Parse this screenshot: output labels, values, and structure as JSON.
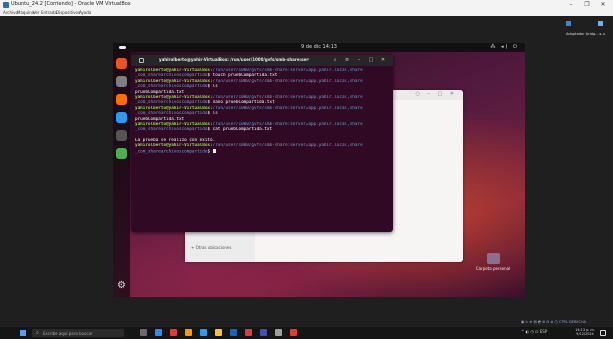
{
  "host_window": {
    "title": "Ubuntu_24.2 [Corriendo] - Oracle VM VirtualBox",
    "menu": [
      "Archivo",
      "Máquina",
      "Ver",
      "Entrada",
      "Dispositivos",
      "Ayuda"
    ],
    "controls": [
      "–",
      "❐",
      "✕"
    ]
  },
  "guest": {
    "clock": "9 de dic 14:13",
    "system_icons": "⁂ ◂) ⏻",
    "terminal": {
      "title": "yahirolberto@yahir-VirtualBox: /run/user/1000/gvfs/smb-share:server=appp...",
      "buttons": [
        "⌕",
        "≡",
        "–",
        "□",
        "✕"
      ],
      "lines": [
        {
          "user": "yahirolberto@yahir-VirtualBox:",
          "path": "/run/user/1000/gvfs/smb-share:server=app.yahir.local,share",
          "cmd": ""
        },
        {
          "user": "",
          "path": "_com_sharearchivoscompartido",
          "cmd": "$ touch pruebCompartida.txt"
        },
        {
          "user": "yahirolberto@yahir-VirtualBox:",
          "path": "/run/user/1000/gvfs/smb-share:server=app.yahir.local,share",
          "cmd": ""
        },
        {
          "user": "",
          "path": "_com_sharearchivoscompartido",
          "cmd": "$ ls"
        },
        {
          "user": "",
          "path": "",
          "cmd": "pruebCompartida.txt"
        },
        {
          "user": "yahirolberto@yahir-VirtualBox:",
          "path": "/run/user/1000/gvfs/smb-share:server=app.yahir.local,share",
          "cmd": ""
        },
        {
          "user": "",
          "path": "_com_sharearchivoscompartido",
          "cmd": "$ nano pruebCompartida.txt"
        },
        {
          "user": "yahirolberto@yahir-VirtualBox:",
          "path": "/run/user/1000/gvfs/smb-share:server=app.yahir.local,share",
          "cmd": ""
        },
        {
          "user": "",
          "path": "_com_sharearchivoscompartido",
          "cmd": "$ ls"
        },
        {
          "user": "",
          "path": "",
          "cmd": "pruebCompartida.txt"
        },
        {
          "user": "yahirolberto@yahir-VirtualBox:",
          "path": "/run/user/1000/gvfs/smb-share:server=app.yahir.local,share",
          "cmd": ""
        },
        {
          "user": "",
          "path": "_com_sharearchivoscompartido",
          "cmd": "$ cat pruebCompartida.txt"
        },
        {
          "user": "",
          "path": "",
          "cmd": ""
        },
        {
          "user": "",
          "path": "",
          "cmd": "La prueba se realizo con exito."
        },
        {
          "user": "yahirolberto@yahir-VirtualBox:",
          "path": "/run/user/1000/gvfs/smb-share:server=app.yahir.local,share",
          "cmd": ""
        },
        {
          "user": "",
          "path": "_com_sharearchivoscompartido",
          "cmd": "$ "
        }
      ]
    },
    "files_window": {
      "other_locations": "+ Otras ubicaciones",
      "controls": "○ – □ ✕"
    },
    "home_folder_label": "Carpeta personal",
    "dock_colors": [
      "#e95420",
      "#7e7e7e",
      "#ff6f00",
      "#2a9bf5",
      "#555555",
      "#4caf50"
    ]
  },
  "host_widget": {
    "label": "Adaptador bridg... ▸ ◂",
    "status_text": "▣ ⊙ ⊕ ▤ ◩ ⊞ ⊟ ⊗ ◫ CTRL DERECHA"
  },
  "taskbar": {
    "search_placeholder": "Escribe aquí para buscar",
    "tray_text": "^ ◐ ◷ ⊡ ESP",
    "time": "14:13 p. m.",
    "date": "9/12/2024",
    "app_colors": [
      "#6a6a6a",
      "#1e90ff",
      "#e53935",
      "#ff9800",
      "#2a9bf5",
      "#fbc02d",
      "#1565c0",
      "#e53935",
      "#3f51b5",
      "#9e9e9e",
      "#e53935"
    ]
  }
}
